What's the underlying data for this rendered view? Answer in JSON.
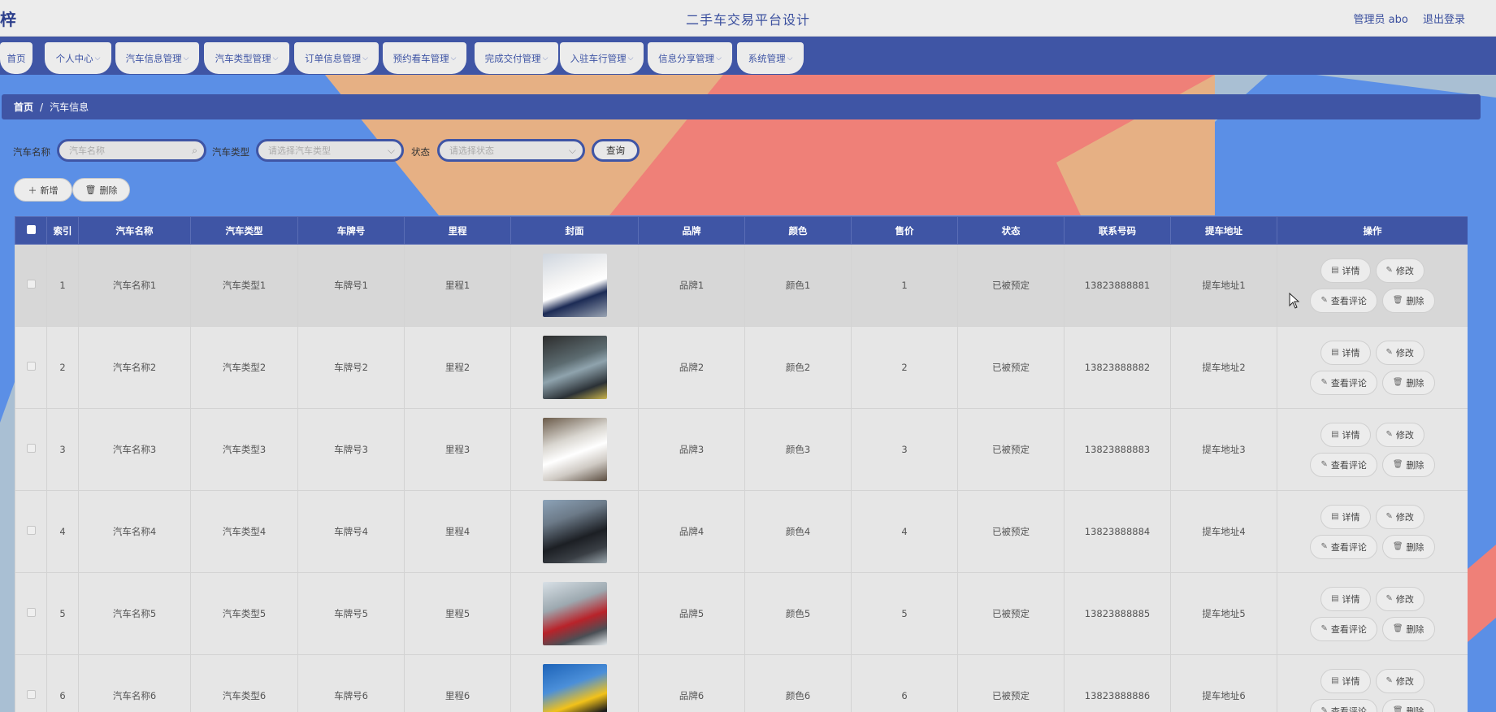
{
  "header": {
    "logo": "梓",
    "site_title": "二手车交易平台设计",
    "admin_label": "管理员 abo",
    "logout_label": "退出登录"
  },
  "nav": {
    "items": [
      {
        "label": "首页",
        "dropdown": false
      },
      {
        "label": "个人中心",
        "dropdown": true
      },
      {
        "label": "汽车信息管理",
        "dropdown": true
      },
      {
        "label": "汽车类型管理",
        "dropdown": true
      },
      {
        "label": "订单信息管理",
        "dropdown": true
      },
      {
        "label": "预约看车管理",
        "dropdown": true
      },
      {
        "label": "完成交付管理",
        "dropdown": true
      },
      {
        "label": "入驻车行管理",
        "dropdown": true
      },
      {
        "label": "信息分享管理",
        "dropdown": true
      },
      {
        "label": "系统管理",
        "dropdown": true
      }
    ]
  },
  "breadcrumb": {
    "home": "首页",
    "separator": "/",
    "current": "汽车信息"
  },
  "search": {
    "name_label": "汽车名称",
    "name_placeholder": "汽车名称",
    "type_label": "汽车类型",
    "type_placeholder": "请选择汽车类型",
    "status_label": "状态",
    "status_placeholder": "请选择状态",
    "query_button": "查询"
  },
  "actions": {
    "add_label": "新增",
    "delete_label": "删除"
  },
  "table": {
    "columns": [
      "索引",
      "汽车名称",
      "汽车类型",
      "车牌号",
      "里程",
      "封面",
      "品牌",
      "颜色",
      "售价",
      "状态",
      "联系号码",
      "提车地址",
      "操作"
    ],
    "op_labels": {
      "detail": "详情",
      "edit": "修改",
      "comments": "查看评论",
      "delete": "删除"
    },
    "rows": [
      {
        "index": "1",
        "name": "汽车名称1",
        "type": "汽车类型1",
        "plate": "车牌号1",
        "mileage": "里程1",
        "brand": "品牌1",
        "color": "颜色1",
        "price": "1",
        "status": "已被预定",
        "phone": "13823888881",
        "address": "提车地址1"
      },
      {
        "index": "2",
        "name": "汽车名称2",
        "type": "汽车类型2",
        "plate": "车牌号2",
        "mileage": "里程2",
        "brand": "品牌2",
        "color": "颜色2",
        "price": "2",
        "status": "已被预定",
        "phone": "13823888882",
        "address": "提车地址2"
      },
      {
        "index": "3",
        "name": "汽车名称3",
        "type": "汽车类型3",
        "plate": "车牌号3",
        "mileage": "里程3",
        "brand": "品牌3",
        "color": "颜色3",
        "price": "3",
        "status": "已被预定",
        "phone": "13823888883",
        "address": "提车地址3"
      },
      {
        "index": "4",
        "name": "汽车名称4",
        "type": "汽车类型4",
        "plate": "车牌号4",
        "mileage": "里程4",
        "brand": "品牌4",
        "color": "颜色4",
        "price": "4",
        "status": "已被预定",
        "phone": "13823888884",
        "address": "提车地址4"
      },
      {
        "index": "5",
        "name": "汽车名称5",
        "type": "汽车类型5",
        "plate": "车牌号5",
        "mileage": "里程5",
        "brand": "品牌5",
        "color": "颜色5",
        "price": "5",
        "status": "已被预定",
        "phone": "13823888885",
        "address": "提车地址5"
      },
      {
        "index": "6",
        "name": "汽车名称6",
        "type": "汽车类型6",
        "plate": "车牌号6",
        "mileage": "里程6",
        "brand": "品牌6",
        "color": "颜色6",
        "price": "6",
        "status": "已被预定",
        "phone": "13823888886",
        "address": "提车地址6"
      }
    ],
    "cover_styles": [
      "linear-gradient(160deg,#cfd6df 0%,#f4f4f4 40%,#ffffff 55%,#1c2b55 70%,#9aa4b3 100%)",
      "linear-gradient(160deg,#2d2d2d 0%,#5c6b70 40%,#8fa3ad 55%,#2b3136 80%,#c9b34a 100%)",
      "linear-gradient(160deg,#6a5a49 0%,#d9d6d0 35%,#ffffff 55%,#cfcac4 75%,#5a4c3f 100%)",
      "linear-gradient(160deg,#8da3b8 0%,#6c7a88 30%,#1c1f24 60%,#3a3f45 80%,#9aa6ad 100%)",
      "linear-gradient(160deg,#d8e0e6 0%,#9da9b0 35%,#b8232a 60%,#4a4f55 80%,#e6ecef 100%)",
      "linear-gradient(160deg,#1d63b8 0%,#4b8fd9 35%,#f2c21a 60%,#1a1a1a 80%,#6f8aa3 100%)"
    ]
  },
  "colors": {
    "primary": "#3f55a5",
    "bg_blue": "#5b8fe6",
    "bg_orange": "#e6b084",
    "bg_salmon": "#ef8078",
    "header_bg": "#ececec"
  }
}
